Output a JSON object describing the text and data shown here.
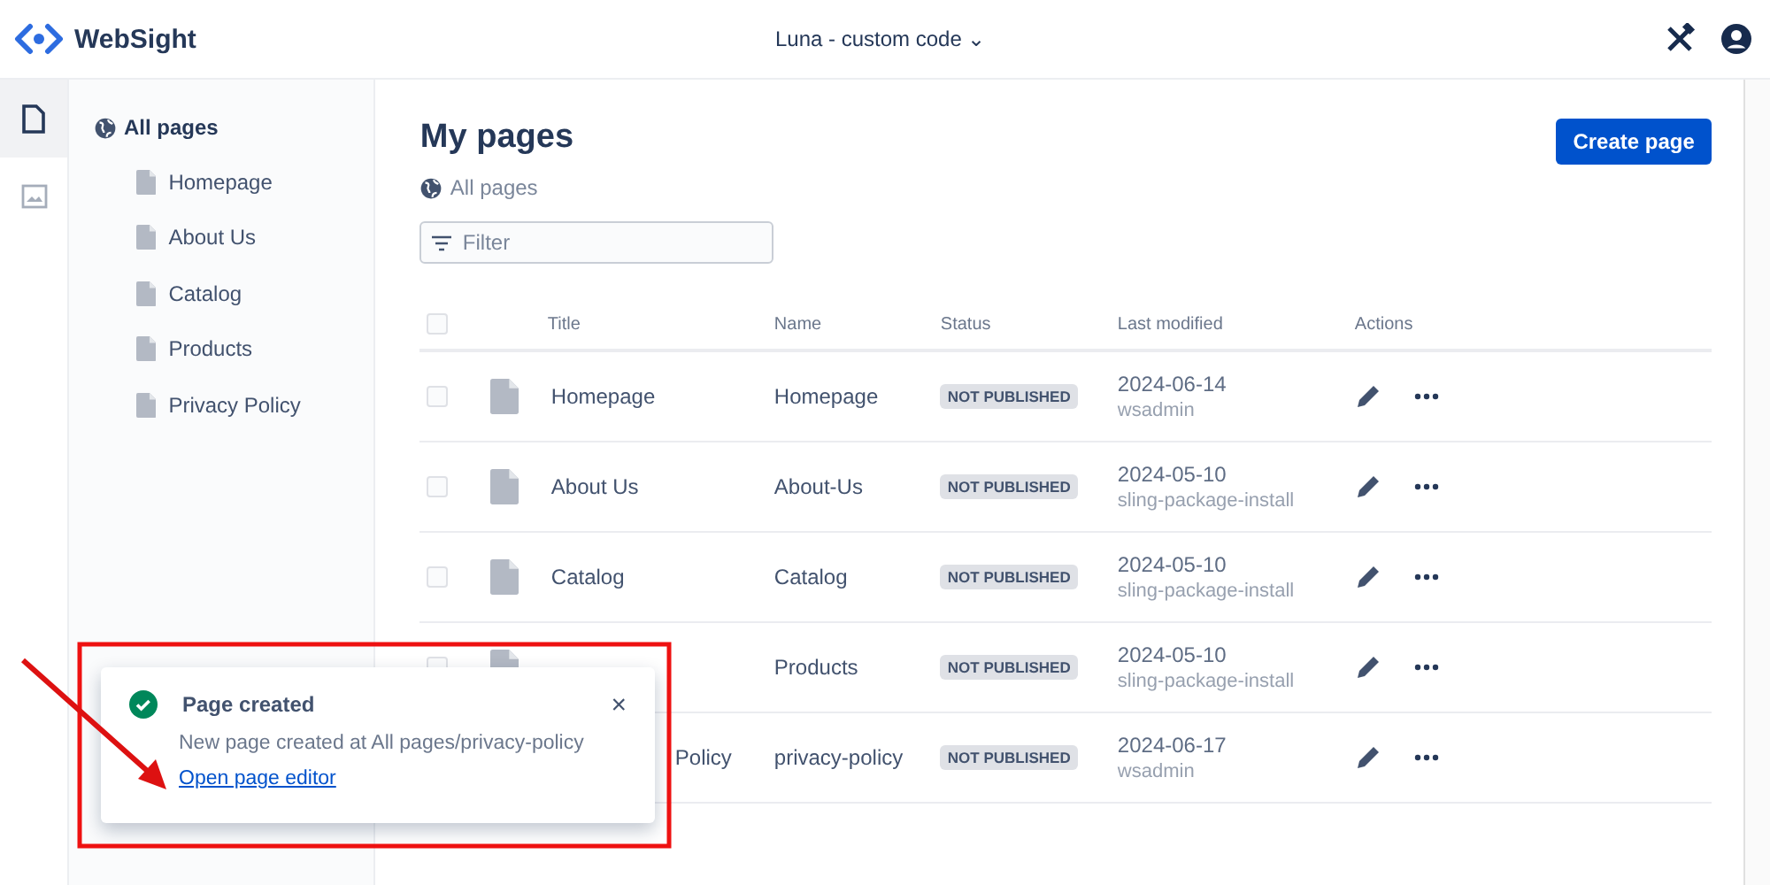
{
  "header": {
    "brand": "WebSight",
    "project": "Luna - custom code",
    "project_caret": "⌄"
  },
  "rail": [
    {
      "kind": "pages",
      "selected": true
    },
    {
      "kind": "assets",
      "selected": false
    }
  ],
  "sidebar": {
    "root": "All pages",
    "items": [
      {
        "label": "Homepage"
      },
      {
        "label": "About Us"
      },
      {
        "label": "Catalog"
      },
      {
        "label": "Products"
      },
      {
        "label": "Privacy Policy"
      }
    ]
  },
  "main": {
    "title": "My pages",
    "breadcrumb": "All pages",
    "create_button": "Create page",
    "filter": {
      "placeholder": "Filter"
    }
  },
  "table": {
    "select_all_checked": false,
    "columns": [
      "Title",
      "Name",
      "Status",
      "Last modified",
      "Actions"
    ],
    "rows": [
      {
        "title": "Homepage",
        "name": "Homepage",
        "status": "NOT PUBLISHED",
        "date": "2024-06-14",
        "user": "wsadmin",
        "checked": false
      },
      {
        "title": "About Us",
        "name": "About-Us",
        "status": "NOT PUBLISHED",
        "date": "2024-05-10",
        "user": "sling-package-install",
        "checked": false
      },
      {
        "title": "Catalog",
        "name": "Catalog",
        "status": "NOT PUBLISHED",
        "date": "2024-05-10",
        "user": "sling-package-install",
        "checked": false
      },
      {
        "name": "Products",
        "status": "NOT PUBLISHED",
        "date": "2024-05-10",
        "user": "sling-package-install",
        "checked": false
      },
      {
        "title": "Policy",
        "title_covered": true,
        "name": "privacy-policy",
        "status": "NOT PUBLISHED",
        "date": "2024-06-17",
        "user": "wsadmin"
      }
    ]
  },
  "toast": {
    "title": "Page created",
    "message": "New page created at All pages/privacy-policy",
    "link": "Open page editor",
    "close": "×"
  }
}
